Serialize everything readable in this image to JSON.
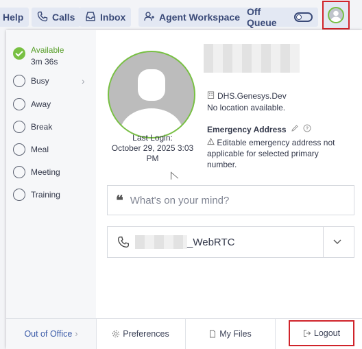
{
  "topbar": {
    "help_label": "Help",
    "calls_label": "Calls",
    "inbox_label": "Inbox",
    "agent_workspace_label": "Agent Workspace",
    "off_queue_label": "Off Queue"
  },
  "status": {
    "items": [
      {
        "label": "Available",
        "sub": "3m 36s",
        "selected": true
      },
      {
        "label": "Busy",
        "has_submenu": true
      },
      {
        "label": "Away"
      },
      {
        "label": "Break"
      },
      {
        "label": "Meal"
      },
      {
        "label": "Meeting"
      },
      {
        "label": "Training"
      }
    ]
  },
  "profile": {
    "last_login_label": "Last Login:",
    "last_login_value": "October 29, 2025 3:03 PM",
    "org": "DHS.Genesys.Dev",
    "location": "No location available.",
    "emergency_title": "Emergency Address",
    "emergency_note": "Editable emergency address not applicable for selected primary number.",
    "status_placeholder": "What's on your mind?",
    "phone_suffix": "_WebRTC"
  },
  "footer": {
    "out_of_office": "Out of Office",
    "preferences": "Preferences",
    "my_files": "My Files",
    "logout": "Logout"
  },
  "colors": {
    "accent_green": "#78c043",
    "nav_blue": "#3a4a78",
    "highlight_red": "#d0232a",
    "available_green": "#5aa02c"
  }
}
